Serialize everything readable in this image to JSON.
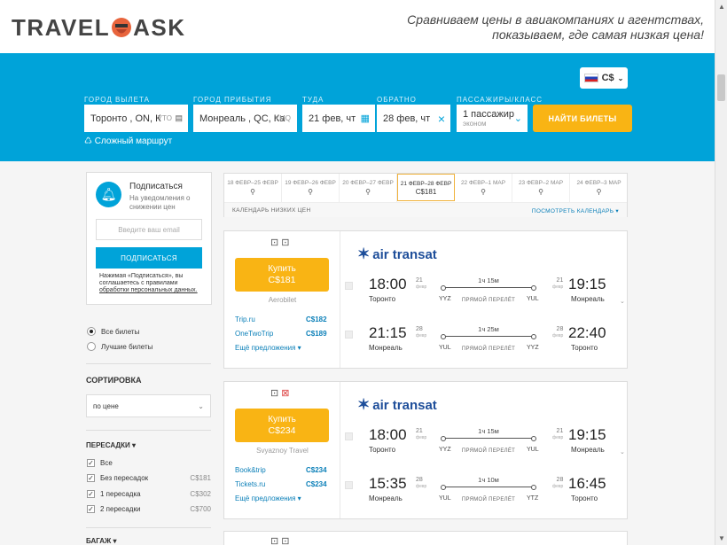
{
  "header": {
    "logo_left": "TRAVEL",
    "logo_right": "ASK",
    "tagline_line1": "Сравниваем цены в авиакомпаниях и агентствах,",
    "tagline_line2": "показываем, где самая низкая цена!"
  },
  "currency": {
    "label": "C$",
    "flag_icon": "russia-flag-icon"
  },
  "search": {
    "from_label": "ГОРОД ВЫЛЕТА",
    "to_label": "ГОРОД ПРИБЫТИЯ",
    "depart_label": "ТУДА",
    "return_label": "ОБРАТНО",
    "pax_label": "ПАССАЖИРЫ/КЛАСС",
    "from_value": "Торонто , ON, К",
    "from_code": "YTO",
    "to_value": "Монреаль , QC, Ка",
    "to_code": "YMQ",
    "depart_value": "21 фев, чт",
    "return_value": "28 фев, чт",
    "pax_value": "1 пассажир",
    "pax_class": "эконом",
    "find_button": "НАЙТИ БИЛЕТЫ",
    "complex_route": "Сложный маршрут"
  },
  "subscribe": {
    "title": "Подписаться",
    "desc": "На уведомления о снижении цен",
    "email_placeholder": "Введите ваш email",
    "button": "ПОДПИСАТЬСЯ",
    "note": "Нажимая «Подписаться», вы соглашаетесь с правилами",
    "note_link": "обработки персональных данных."
  },
  "filters": {
    "all_tickets": "Все билеты",
    "best_tickets": "Лучшие билеты",
    "sort_heading": "СОРТИРОВКА",
    "sort_value": "по цене",
    "transfers_heading": "ПЕРЕСАДКИ ▾",
    "transfers": [
      {
        "label": "Все",
        "price": ""
      },
      {
        "label": "Без пересадок",
        "price": "C$181"
      },
      {
        "label": "1 пересадка",
        "price": "C$302"
      },
      {
        "label": "2 пересадки",
        "price": "C$700"
      }
    ],
    "baggage_heading": "БАГАЖ ▾"
  },
  "calendar": {
    "days": [
      {
        "range": "18 ФЕВР–25 ФЕВР",
        "price": ""
      },
      {
        "range": "19 ФЕВР–26 ФЕВР",
        "price": ""
      },
      {
        "range": "20 ФЕВР–27 ФЕВР",
        "price": ""
      },
      {
        "range": "21 ФЕВР–28 ФЕВР",
        "price": "C$181"
      },
      {
        "range": "22 ФЕВР–1 МАР",
        "price": ""
      },
      {
        "range": "23 ФЕВР–2 МАР",
        "price": ""
      },
      {
        "range": "24 ФЕВР–3 МАР",
        "price": ""
      }
    ],
    "low_prices": "КАЛЕНДАРЬ НИЗКИХ ЦЕН",
    "view_calendar": "ПОСМОТРЕТЬ КАЛЕНДАРЬ ▾"
  },
  "results": [
    {
      "buy_label": "Купить",
      "price": "C$181",
      "agent": "Aerobilet",
      "offers": [
        {
          "name": "Trip.ru",
          "price": "C$182"
        },
        {
          "name": "OneTwoTrip",
          "price": "C$189"
        }
      ],
      "more": "Ещё предложения ▾",
      "airline": "air transat",
      "segments": [
        {
          "dep_time": "18:00",
          "dep_day": "21",
          "dep_month": "февр",
          "dep_city": "Торонто",
          "dep_code": "YYZ",
          "duration": "1ч 15м",
          "direct": "ПРЯМОЙ ПЕРЕЛЁТ",
          "arr_code": "YUL",
          "arr_day": "21",
          "arr_month": "февр",
          "arr_time": "19:15",
          "arr_city": "Монреаль"
        },
        {
          "dep_time": "21:15",
          "dep_day": "28",
          "dep_month": "февр",
          "dep_city": "Монреаль",
          "dep_code": "YUL",
          "duration": "1ч 25м",
          "direct": "ПРЯМОЙ ПЕРЕЛЁТ",
          "arr_code": "YYZ",
          "arr_day": "28",
          "arr_month": "февр",
          "arr_time": "22:40",
          "arr_city": "Торонто"
        }
      ]
    },
    {
      "buy_label": "Купить",
      "price": "C$234",
      "agent": "Svyaznoy Travel",
      "offers": [
        {
          "name": "Book&trip",
          "price": "C$234"
        },
        {
          "name": "Tickets.ru",
          "price": "C$234"
        }
      ],
      "more": "Ещё предложения ▾",
      "airline": "air transat",
      "segments": [
        {
          "dep_time": "18:00",
          "dep_day": "21",
          "dep_month": "февр",
          "dep_city": "Торонто",
          "dep_code": "YYZ",
          "duration": "1ч 15м",
          "direct": "ПРЯМОЙ ПЕРЕЛЁТ",
          "arr_code": "YUL",
          "arr_day": "21",
          "arr_month": "февр",
          "arr_time": "19:15",
          "arr_city": "Монреаль"
        },
        {
          "dep_time": "15:35",
          "dep_day": "28",
          "dep_month": "февр",
          "dep_city": "Монреаль",
          "dep_code": "YUL",
          "duration": "1ч 10м",
          "direct": "ПРЯМОЙ ПЕРЕЛЁТ",
          "arr_code": "YTZ",
          "arr_day": "28",
          "arr_month": "февр",
          "arr_time": "16:45",
          "arr_city": "Торонто"
        }
      ]
    }
  ]
}
